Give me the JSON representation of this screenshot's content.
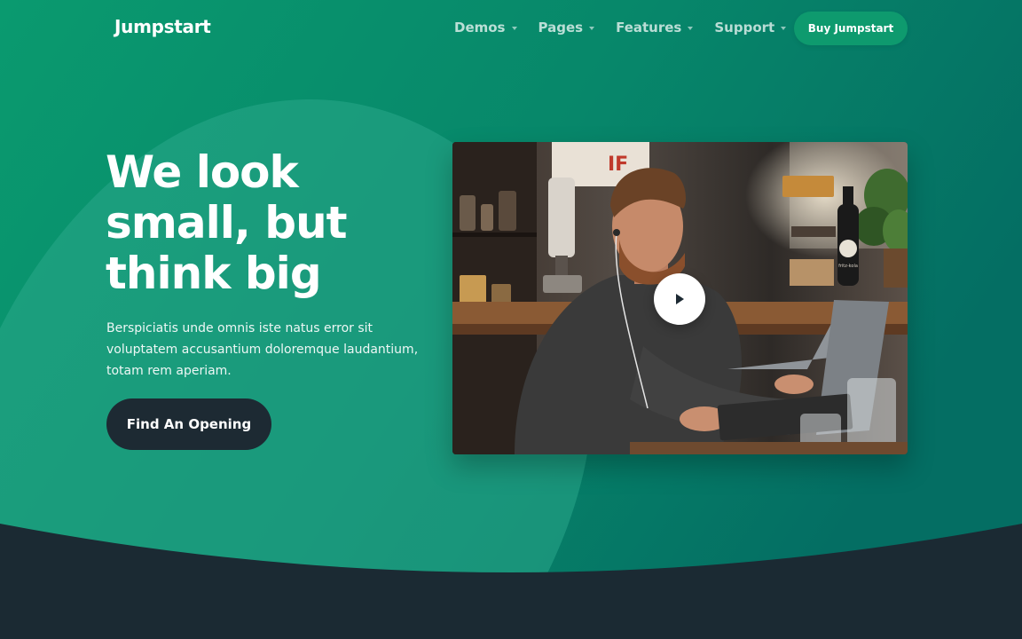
{
  "nav": {
    "brand": "Jumpstart",
    "menu": [
      {
        "label": "Demos"
      },
      {
        "label": "Pages"
      },
      {
        "label": "Features"
      },
      {
        "label": "Support"
      }
    ],
    "cta_label": "Buy Jumpstart"
  },
  "hero": {
    "headline_lines": [
      "We look",
      "small, but",
      "think big"
    ],
    "lead": "Berspiciatis unde omnis iste natus error sit voluptatem accusantium doloremque laudantium, totam rem aperiam.",
    "button_label": "Find An Opening"
  },
  "video": {
    "play_icon": "play-icon",
    "sign_text": "IF",
    "bottle_label": "fritz-kola"
  },
  "colors": {
    "hero_green": "#0a9a6f",
    "hero_green_dark": "#057064",
    "blob": "#21a184",
    "dark": "#1b2a33",
    "button_green": "#0e9a6e"
  }
}
